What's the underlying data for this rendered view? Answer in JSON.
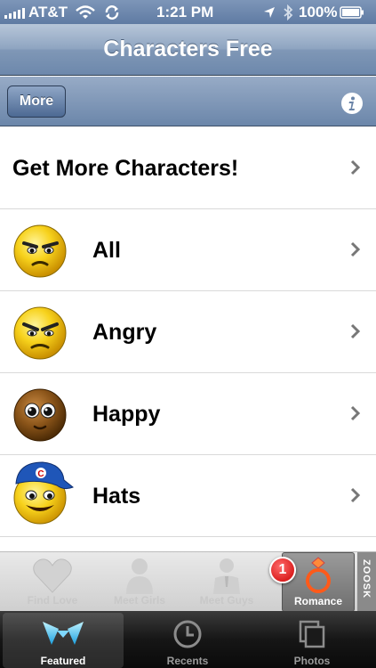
{
  "status_bar": {
    "carrier": "AT&T",
    "time": "1:21 PM",
    "battery": "100%",
    "icons": [
      "signal-bars-icon",
      "wifi-icon",
      "sync-icon",
      "location-arrow-icon",
      "bluetooth-icon",
      "battery-icon"
    ]
  },
  "nav": {
    "title": "Characters Free"
  },
  "toolbar": {
    "more_label": "More",
    "info_icon": "info-icon"
  },
  "list": {
    "rows": [
      {
        "label": "Get More Characters!"
      },
      {
        "label": "All",
        "icon": "grumpy-face-icon"
      },
      {
        "label": "Angry",
        "icon": "angry-face-icon"
      },
      {
        "label": "Happy",
        "icon": "brown-face-icon"
      },
      {
        "label": "Hats",
        "icon": "cap-face-icon"
      }
    ]
  },
  "ad_bar": {
    "items": [
      {
        "label": "Find Love",
        "icon": "heart-icon"
      },
      {
        "label": "Meet Girls",
        "icon": "girl-icon"
      },
      {
        "label": "Meet Guys",
        "icon": "guy-icon"
      },
      {
        "label": "Romance",
        "icon": "ring-icon"
      }
    ],
    "badge": "1",
    "brand": "ZOOSK"
  },
  "tab_bar": {
    "tabs": [
      {
        "label": "Featured",
        "icon": "featured-icon",
        "selected": true
      },
      {
        "label": "Recents",
        "icon": "clock-icon"
      },
      {
        "label": "Photos",
        "icon": "photos-icon"
      }
    ]
  }
}
